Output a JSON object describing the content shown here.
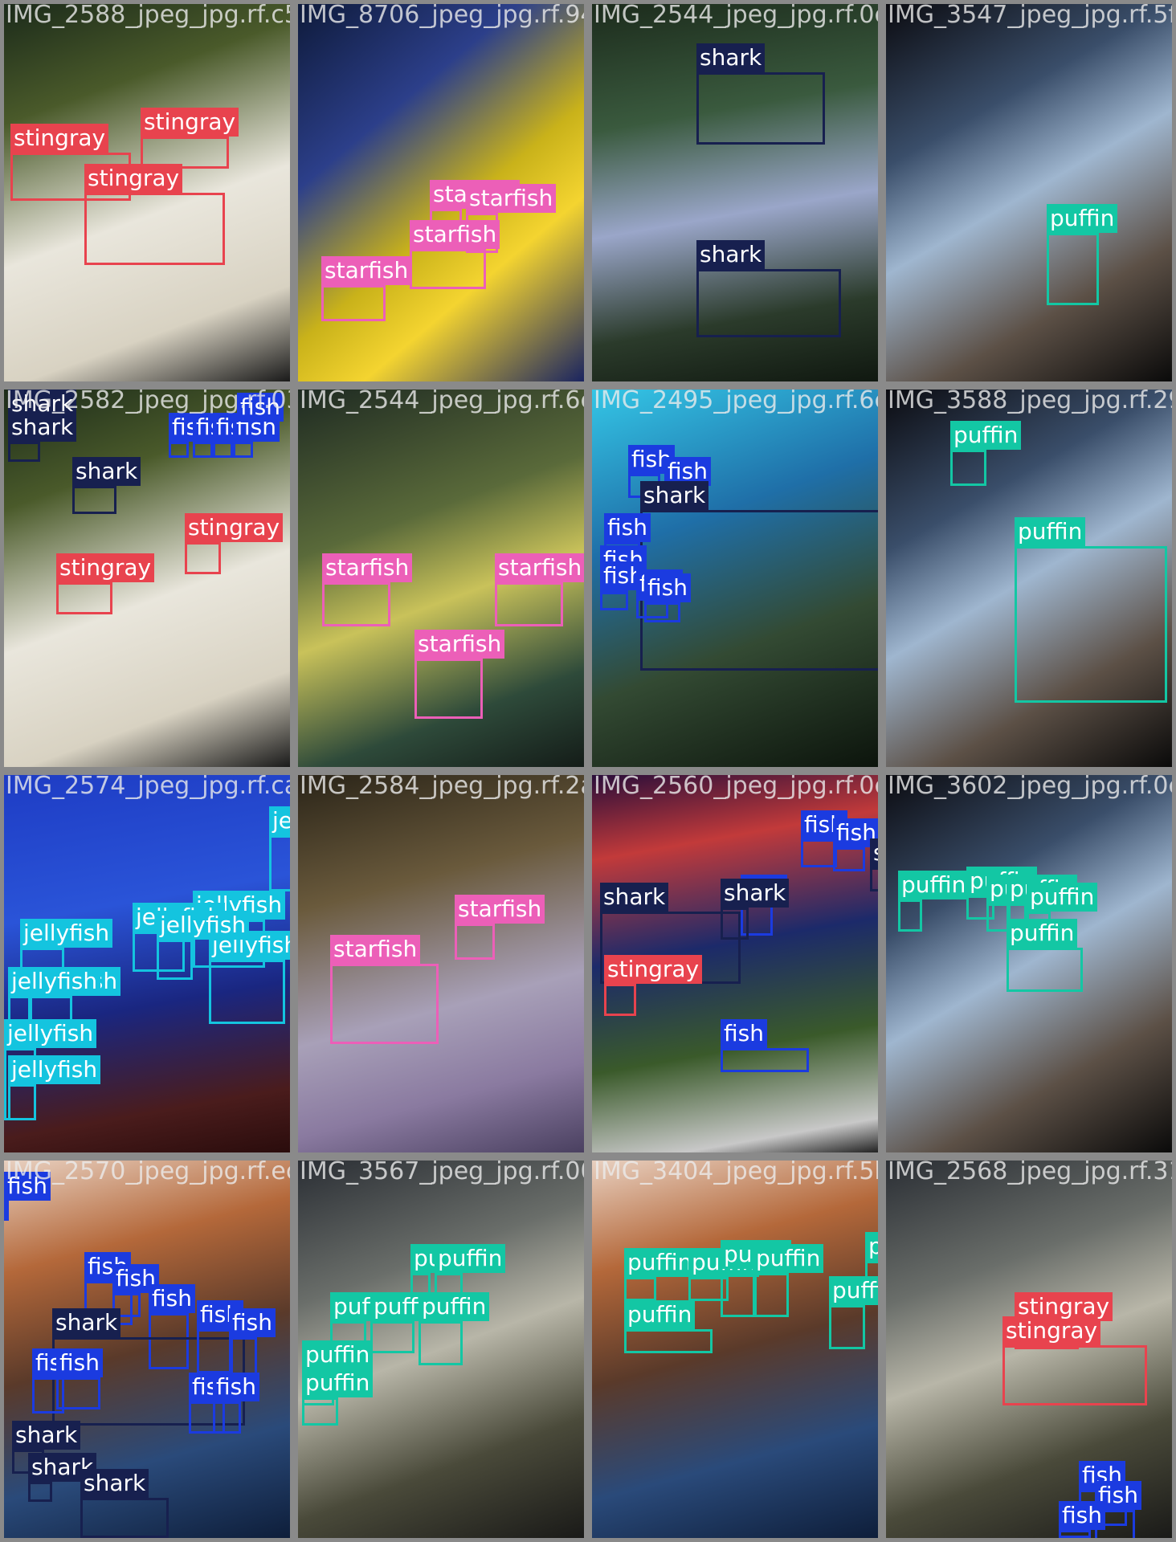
{
  "classes": {
    "stingray": "#e8434e",
    "starfish": "#ec5fb8",
    "shark": "#17204f",
    "puffin": "#13c7a4",
    "fish": "#1b3be0",
    "jellyfish": "#14c4df"
  },
  "tiles": [
    {
      "filename": "IMG_2588_jpeg_jpg.rf.c5",
      "scene": "ray",
      "detections": [
        {
          "label": "stingray"
        },
        {
          "label": "stingray"
        },
        {
          "label": "stingray"
        }
      ]
    },
    {
      "filename": "IMG_8706_jpeg_jpg.rf.94",
      "scene": "kelp",
      "detections": [
        {
          "label": "starfish"
        },
        {
          "label": "starfish"
        },
        {
          "label": "starfish"
        },
        {
          "label": "starfish"
        }
      ]
    },
    {
      "filename": "IMG_2544_jpeg_jpg.rf.0c",
      "scene": "deep",
      "detections": [
        {
          "label": "shark"
        },
        {
          "label": "shark"
        }
      ]
    },
    {
      "filename": "IMG_3547_jpeg_jpg.rf.5f",
      "scene": "rock",
      "detections": [
        {
          "label": "puffin"
        }
      ]
    },
    {
      "filename": "IMG_2582_jpeg_jpg.rf.03",
      "scene": "ray",
      "detections": [
        {
          "label": "shark"
        },
        {
          "label": "fish"
        },
        {
          "label": "fish"
        },
        {
          "label": "fish"
        },
        {
          "label": "fish"
        },
        {
          "label": "fish"
        },
        {
          "label": "shark"
        },
        {
          "label": "shark"
        },
        {
          "label": "stingray"
        },
        {
          "label": "stingray"
        }
      ]
    },
    {
      "filename": "IMG_2544_jpeg_jpg.rf.6c",
      "scene": "reef",
      "detections": [
        {
          "label": "starfish"
        },
        {
          "label": "starfish"
        },
        {
          "label": "starfish"
        }
      ]
    },
    {
      "filename": "IMG_2495_jpeg_jpg.rf.6c",
      "scene": "blue",
      "detections": [
        {
          "label": "fish"
        },
        {
          "label": "fish"
        },
        {
          "label": "shark"
        },
        {
          "label": "fish"
        },
        {
          "label": "fish"
        },
        {
          "label": "fish"
        },
        {
          "label": "fish"
        },
        {
          "label": "fish"
        }
      ]
    },
    {
      "filename": "IMG_3588_jpeg_jpg.rf.29",
      "scene": "rock",
      "detections": [
        {
          "label": "puffin"
        },
        {
          "label": "puffin"
        }
      ]
    },
    {
      "filename": "IMG_2574_jpeg_jpg.rf.ca",
      "scene": "jelly",
      "detections": [
        {
          "label": "jellyfish"
        },
        {
          "label": "jellyfish"
        },
        {
          "label": "jellyfish"
        },
        {
          "label": "jellyfish"
        },
        {
          "label": "jellyfish"
        },
        {
          "label": "jellyfish"
        },
        {
          "label": "jellyfish"
        },
        {
          "label": "jellyfish"
        },
        {
          "label": "jellyfish"
        },
        {
          "label": "jellyfish"
        }
      ]
    },
    {
      "filename": "IMG_2584_jpeg_jpg.rf.2a",
      "scene": "gravel",
      "detections": [
        {
          "label": "starfish"
        },
        {
          "label": "starfish"
        }
      ]
    },
    {
      "filename": "IMG_2560_jpeg_jpg.rf.0c",
      "scene": "tunnel",
      "detections": [
        {
          "label": "fish"
        },
        {
          "label": "fish"
        },
        {
          "label": "shark"
        },
        {
          "label": "fish"
        },
        {
          "label": "shark"
        },
        {
          "label": "fish"
        },
        {
          "label": "shark"
        },
        {
          "label": "stingray"
        }
      ]
    },
    {
      "filename": "IMG_3602_jpeg_jpg.rf.0c",
      "scene": "rock",
      "detections": [
        {
          "label": "puffin"
        },
        {
          "label": "puffin"
        },
        {
          "label": "puffin"
        },
        {
          "label": "puffin"
        },
        {
          "label": "puffin"
        },
        {
          "label": "puffin"
        }
      ]
    },
    {
      "filename": "IMG_2570_jpeg_jpg.rf.ec",
      "scene": "warm",
      "detections": [
        {
          "label": "fish"
        },
        {
          "label": "fish"
        },
        {
          "label": "fish"
        },
        {
          "label": "fish"
        },
        {
          "label": "shark"
        },
        {
          "label": "fish"
        },
        {
          "label": "fish"
        },
        {
          "label": "fish"
        },
        {
          "label": "fish"
        },
        {
          "label": "fish"
        },
        {
          "label": "fish"
        },
        {
          "label": "shark"
        },
        {
          "label": "shark"
        },
        {
          "label": "shark"
        }
      ]
    },
    {
      "filename": "IMG_3567_jpeg_jpg.rf.00",
      "scene": "cliff",
      "detections": [
        {
          "label": "puffin"
        },
        {
          "label": "puffin"
        },
        {
          "label": "puffin"
        },
        {
          "label": "puffin"
        },
        {
          "label": "puffin"
        },
        {
          "label": "puffin"
        },
        {
          "label": "puffin"
        }
      ]
    },
    {
      "filename": "IMG_3404_jpeg_jpg.rf.5b",
      "scene": "warm",
      "detections": [
        {
          "label": "puffin"
        },
        {
          "label": "puffin"
        },
        {
          "label": "puffin"
        },
        {
          "label": "puffin"
        },
        {
          "label": "puffin"
        },
        {
          "label": "puffin"
        },
        {
          "label": "puffin"
        }
      ]
    },
    {
      "filename": "IMG_2568_jpeg_jpg.rf.31",
      "scene": "cliff",
      "detections": [
        {
          "label": "stingray"
        },
        {
          "label": "stingray"
        },
        {
          "label": "fish"
        },
        {
          "label": "fish"
        },
        {
          "label": "fish"
        }
      ]
    }
  ]
}
